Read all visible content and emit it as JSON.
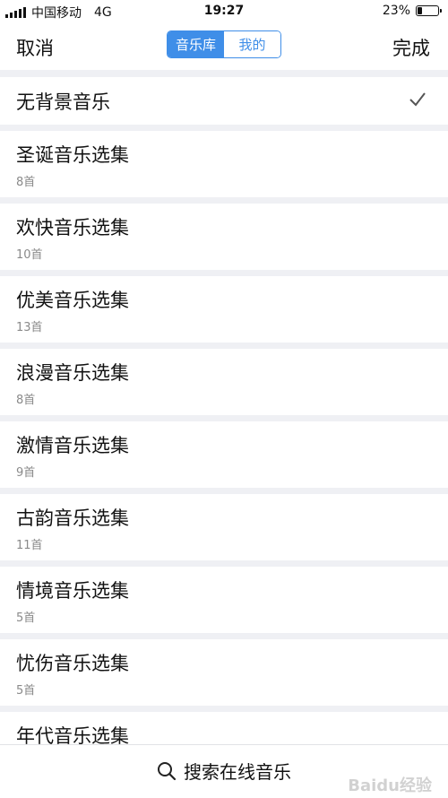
{
  "status_bar": {
    "carrier": "中国移动",
    "network": "4G",
    "time": "19:27",
    "battery_percent": "23%",
    "battery_level": 0.23
  },
  "nav": {
    "cancel": "取消",
    "done": "完成",
    "tabs": [
      {
        "label": "音乐库",
        "active": true
      },
      {
        "label": "我的",
        "active": false
      }
    ]
  },
  "list": {
    "none_option": {
      "label": "无背景音乐",
      "selected": true
    },
    "items": [
      {
        "title": "圣诞音乐选集",
        "count": "8首"
      },
      {
        "title": "欢快音乐选集",
        "count": "10首"
      },
      {
        "title": "优美音乐选集",
        "count": "13首"
      },
      {
        "title": "浪漫音乐选集",
        "count": "8首"
      },
      {
        "title": "激情音乐选集",
        "count": "9首"
      },
      {
        "title": "古韵音乐选集",
        "count": "11首"
      },
      {
        "title": "情境音乐选集",
        "count": "5首"
      },
      {
        "title": "忧伤音乐选集",
        "count": "5首"
      },
      {
        "title": "年代音乐选集",
        "count": ""
      }
    ]
  },
  "bottom": {
    "search_label": "搜索在线音乐"
  },
  "colors": {
    "accent": "#3f8ee8",
    "background": "#eff0f4"
  },
  "watermark": "Baidu经验"
}
